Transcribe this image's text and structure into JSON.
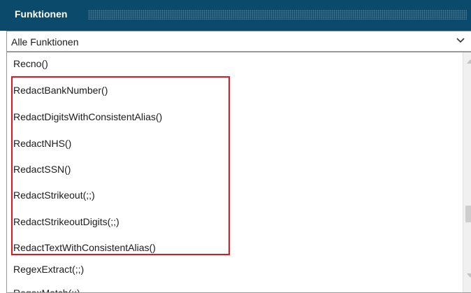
{
  "panel": {
    "title": "Funktionen"
  },
  "filter": {
    "selected": "Alle Funktionen"
  },
  "functions": [
    "Recno()",
    "RedactBankNumber()",
    "RedactDigitsWithConsistentAlias()",
    "RedactNHS()",
    "RedactSSN()",
    "RedactStrikeout(;;)",
    "RedactStrikeoutDigits(;;)",
    "RedactTextWithConsistentAlias()",
    "RegexExtract(;;)",
    "RegexMatch(;;)"
  ],
  "icons": {
    "dropdown": "chevron-down-icon",
    "scroll_up": "scroll-up-arrow-icon",
    "scroll_down": "scroll-down-arrow-icon"
  },
  "colors": {
    "header": "#0b4a6a",
    "highlight": "#e8141c"
  }
}
